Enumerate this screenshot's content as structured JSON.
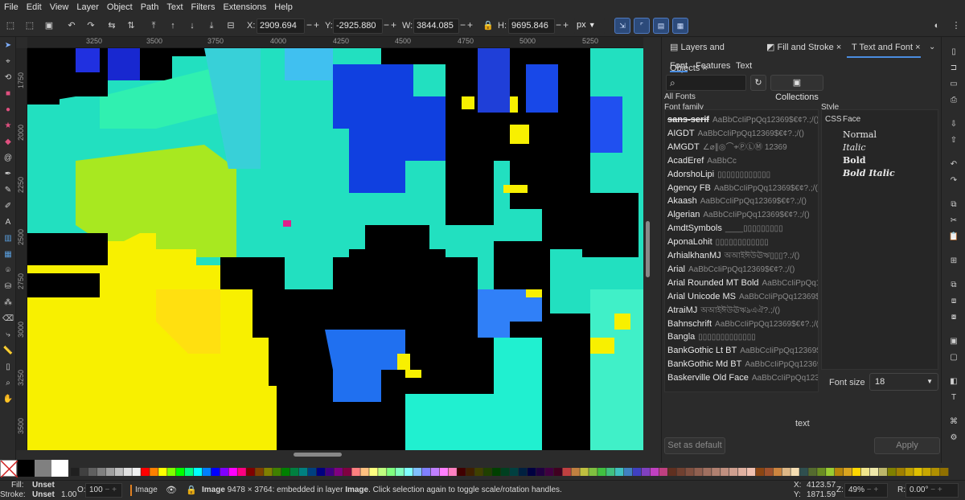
{
  "menu": [
    "File",
    "Edit",
    "View",
    "Layer",
    "Object",
    "Path",
    "Text",
    "Filters",
    "Extensions",
    "Help"
  ],
  "toolbar": {
    "x_label": "X:",
    "x_value": "2909.694",
    "y_label": "Y:",
    "y_value": "-2925.880",
    "w_label": "W:",
    "w_value": "3844.085",
    "h_label": "H:",
    "h_value": "9695.846",
    "unit": "px",
    "minus": "−",
    "plus": "+"
  },
  "ruler": {
    "h_labels": [
      "3250",
      "3500",
      "3750",
      "4000",
      "4250",
      "4500",
      "4750",
      "5000",
      "5250"
    ],
    "v_labels": [
      "1750",
      "2000",
      "2250",
      "2500",
      "2750",
      "3000",
      "3250",
      "3500"
    ]
  },
  "panel": {
    "tabs": [
      "Layers and Objects",
      "Fill and Stroke",
      "Text and Font"
    ],
    "close_glyph": "×",
    "subtabs": [
      "Font",
      "Features",
      "Text"
    ],
    "collections_label": "Collections",
    "all_fonts_label": "All Fonts",
    "font_family_label": "Font family",
    "style_label": "Style",
    "css_header": "CSS",
    "face_header": "Face",
    "fonts": [
      {
        "name": "sans-serif",
        "sample": "AaBbCcIiPpQq12369$€¢?.;/()"
      },
      {
        "name": "AIGDT",
        "sample": "AaBbCcIiPpQq12369$€¢?.;/()"
      },
      {
        "name": "AMGDT",
        "sample": "∠⌀∥◎⌒⌖ⓅⓁⓂ 12369"
      },
      {
        "name": "AcadEref",
        "sample": "AaBbCc"
      },
      {
        "name": "AdorshoLipi",
        "sample": "▯▯▯▯▯▯▯▯▯▯▯▯"
      },
      {
        "name": "Agency FB",
        "sample": "AaBbCcIiPpQq12369$€¢?.;/()"
      },
      {
        "name": "Akaash",
        "sample": "AaBbCcIiPpQq12369$€¢?.;/()"
      },
      {
        "name": "Algerian",
        "sample": "AaBbCcIiPpQq12369$€¢?.;/()"
      },
      {
        "name": "AmdtSymbols",
        "sample": "____▯▯▯▯▯▯▯▯▯"
      },
      {
        "name": "AponaLohit",
        "sample": "▯▯▯▯▯▯▯▯▯▯▯▯"
      },
      {
        "name": "ArhialkhanMJ",
        "sample": "অআইঈউঊঋ▯▯▯?.;/()"
      },
      {
        "name": "Arial",
        "sample": "AaBbCcIiPpQq12369$€¢?.;/()"
      },
      {
        "name": "Arial Rounded MT Bold",
        "sample": "AaBbCcIiPpQq12369"
      },
      {
        "name": "Arial Unicode MS",
        "sample": "AaBbCcIiPpQq12369$€¢?."
      },
      {
        "name": "AtraiMJ",
        "sample": "অআইঈউঊঋঌএঐ?.;/()"
      },
      {
        "name": "Bahnschrift",
        "sample": "AaBbCcIiPpQq12369$€¢?.;/()"
      },
      {
        "name": "Bangla",
        "sample": "▯▯▯▯▯▯▯▯▯▯▯▯▯"
      },
      {
        "name": "BankGothic Lt BT",
        "sample": "AaBbCcIiPpQq12369$€¢?.;/"
      },
      {
        "name": "BankGothic Md BT",
        "sample": "AaBbCcIiPpQq12369$€¢?."
      },
      {
        "name": "Baskerville Old Face",
        "sample": "AaBbCcIiPpQq12369$€¢?.;/()"
      }
    ],
    "styles": [
      "Normal",
      "Italic",
      "Bold",
      "Bold Italic"
    ],
    "font_size_label": "Font size",
    "font_size_value": "18",
    "preview_text": "text",
    "set_default_label": "Set as default",
    "apply_label": "Apply"
  },
  "status": {
    "fill_label": "Fill:",
    "fill_value": "Unset",
    "stroke_label": "Stroke:",
    "stroke_value": "Unset",
    "stroke_width": "1.00",
    "opacity_label": "O:",
    "opacity_value": "100",
    "layer_name": "Image",
    "message_bold": "Image",
    "message_rest": " 9478 × 3764: embedded in layer ",
    "message_layer": "Image",
    "message_end": ". Click selection again to toggle scale/rotation handles.",
    "cursor_x_label": "X:",
    "cursor_x": "4123.57",
    "cursor_y_label": "Y:",
    "cursor_y": "1871.59",
    "zoom_label": "Z:",
    "zoom_value": "49%",
    "rotation_label": "R:",
    "rotation_value": "0.00°"
  },
  "colors": {
    "accent": "#4a8de0",
    "canvas_cyan": "#22e0c0",
    "canvas_yellow": "#f8f000",
    "canvas_blue": "#1040e0"
  }
}
